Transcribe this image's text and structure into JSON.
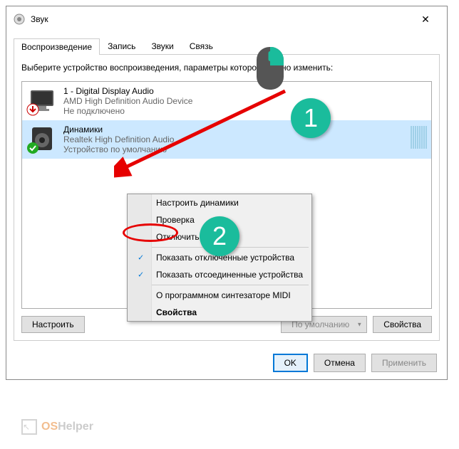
{
  "titlebar": {
    "title": "Звук"
  },
  "tabs": {
    "playback": "Воспроизведение",
    "recording": "Запись",
    "sounds": "Звуки",
    "communications": "Связь"
  },
  "instruction": "Выберите устройство воспроизведения, параметры которого нужно изменить:",
  "devices": [
    {
      "name": "1 - Digital Display Audio",
      "desc": "AMD High Definition Audio Device",
      "status": "Не подключено"
    },
    {
      "name": "Динамики",
      "desc": "Realtek High Definition Audio",
      "status": "Устройство по умолчанию"
    }
  ],
  "context_menu": {
    "configure": "Настроить динамики",
    "test": "Проверка",
    "disable": "Отключить",
    "show_disabled": "Показать отключенные устройства",
    "show_disconnected": "Показать отсоединенные устройства",
    "about_midi": "О программном синтезаторе MIDI",
    "properties": "Свойства"
  },
  "buttons": {
    "configure": "Настроить",
    "set_default": "По умолчанию",
    "properties": "Свойства",
    "ok": "OK",
    "cancel": "Отмена",
    "apply": "Применить"
  },
  "watermark": {
    "part1": "OS",
    "part2": "Helper"
  },
  "annotations": {
    "number1": "1",
    "number2": "2"
  }
}
